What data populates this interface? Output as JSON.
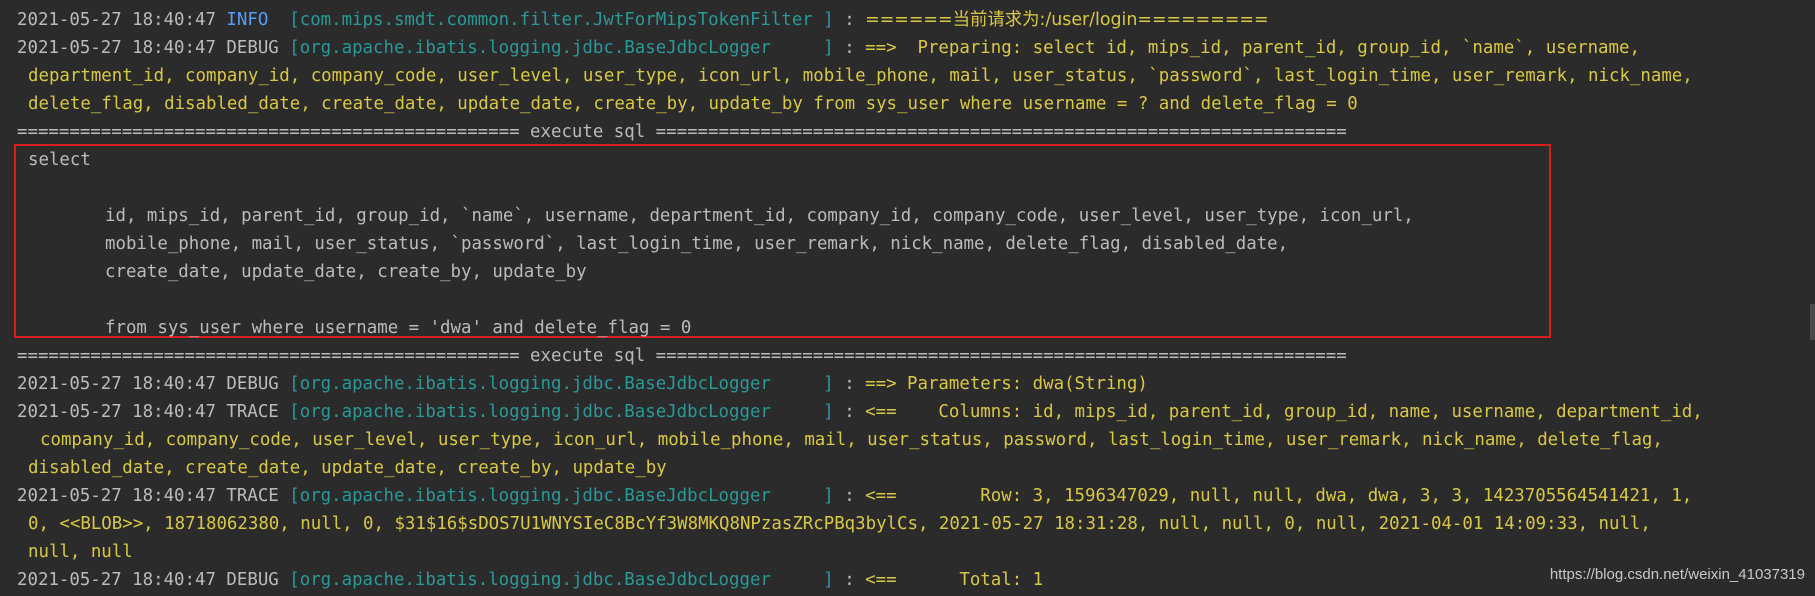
{
  "entries": [
    {
      "timestamp": "2021-05-27 18:40:47",
      "level": "INFO",
      "logger": "[com.mips.smdt.common.filter.JwtForMipsTokenFilter ]",
      "separator": " : ",
      "message": "======当前请求为:/user/login========="
    },
    {
      "timestamp": "2021-05-27 18:40:47",
      "level": "DEBUG",
      "logger": "[org.apache.ibatis.logging.jdbc.BaseJdbcLogger     ]",
      "separator": " : ",
      "message": "==>  Preparing: select id, mips_id, parent_id, group_id, `name`, username,",
      "continuation": [
        "department_id, company_id, company_code, user_level, user_type, icon_url, mobile_phone, mail, user_status, `password`, last_login_time, user_remark, nick_name,",
        "delete_flag, disabled_date, create_date, update_date, create_by, update_by from sys_user where username = ? and delete_flag = 0"
      ]
    },
    {
      "timestamp": "2021-05-27 18:40:47",
      "level": "DEBUG",
      "logger": "[org.apache.ibatis.logging.jdbc.BaseJdbcLogger     ]",
      "separator": " : ",
      "message": "==> Parameters: dwa(String)"
    },
    {
      "timestamp": "2021-05-27 18:40:47",
      "level": "TRACE",
      "logger": "[org.apache.ibatis.logging.jdbc.BaseJdbcLogger     ]",
      "separator": " : ",
      "message": "<==    Columns: id, mips_id, parent_id, group_id, name, username, department_id,",
      "continuation": [
        "company_id, company_code, user_level, user_type, icon_url, mobile_phone, mail, user_status, password, last_login_time, user_remark, nick_name, delete_flag,",
        "disabled_date, create_date, update_date, create_by, update_by"
      ]
    },
    {
      "timestamp": "2021-05-27 18:40:47",
      "level": "TRACE",
      "logger": "[org.apache.ibatis.logging.jdbc.BaseJdbcLogger     ]",
      "separator": " : ",
      "message": "<==        Row: 3, 1596347029, null, null, dwa, dwa, 3, 3, 1423705564541421, 1,",
      "continuation": [
        "0, <<BLOB>>, 18718062380, null, 0, $31$16$sDOS7U1WNYSIeC8BcYf3W8MKQ8NPzasZRcPBq3bylCs, 2021-05-27 18:31:28, null, null, 0, null, 2021-04-01 14:09:33, null,",
        "null, null"
      ]
    },
    {
      "timestamp": "2021-05-27 18:40:47",
      "level": "DEBUG",
      "logger": "[org.apache.ibatis.logging.jdbc.BaseJdbcLogger     ]",
      "separator": " : ",
      "message": "<==      Total: 1"
    }
  ],
  "execute_sql_divider": "================================================ execute sql ==================================================================",
  "sql_block": {
    "keyword": "select",
    "columns_1": "id, mips_id, parent_id, group_id, `name`, username, department_id, company_id, company_code, user_level, user_type, icon_url,",
    "columns_2": "mobile_phone, mail, user_status, `password`, last_login_time, user_remark, nick_name, delete_flag, disabled_date,",
    "columns_3": "create_date, update_date, create_by, update_by",
    "from_clause": "from sys_user where username = 'dwa' and delete_flag = 0"
  },
  "watermark": "https://blog.csdn.net/weixin_41037319",
  "colors": {
    "background": "#2b2b2b",
    "info_level": "#589df6",
    "logger": "#299999",
    "message": "#d9c845",
    "plain_text": "#bbbbbb",
    "highlight_border": "#d61f1f"
  }
}
